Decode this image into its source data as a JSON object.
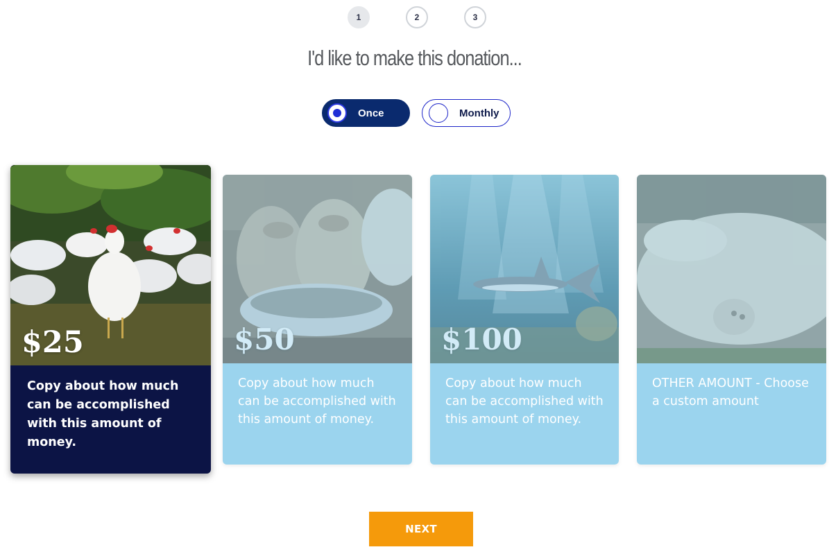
{
  "steps": [
    "1",
    "2",
    "3"
  ],
  "active_step": "1",
  "heading": "I'd like to make this donation...",
  "frequency": {
    "once_label": "Once",
    "monthly_label": "Monthly",
    "selected": "Once"
  },
  "cards": [
    {
      "amount": "$25",
      "copy": "Copy about how much can be accomplished with this amount of money.",
      "image": "chickens-photo",
      "selected": true
    },
    {
      "amount": "$50",
      "copy": "Copy about how much can be accomplished with this amount of money.",
      "image": "calves-drinking-photo",
      "selected": false
    },
    {
      "amount": "$100",
      "copy": "Copy about how much can be accomplished with this amount of money.",
      "image": "shark-underwater-photo",
      "selected": false
    },
    {
      "amount": "",
      "copy": "OTHER AMOUNT - Choose a custom amount",
      "image": "pig-lying-photo",
      "selected": false
    }
  ],
  "next_label": "NEXT",
  "colors": {
    "navy": "#0c1445",
    "once_button": "#0a2a6e",
    "card_light": "#9bd4ee",
    "accent_orange": "#f59a0b",
    "radio_blue": "#1f2ed6"
  }
}
